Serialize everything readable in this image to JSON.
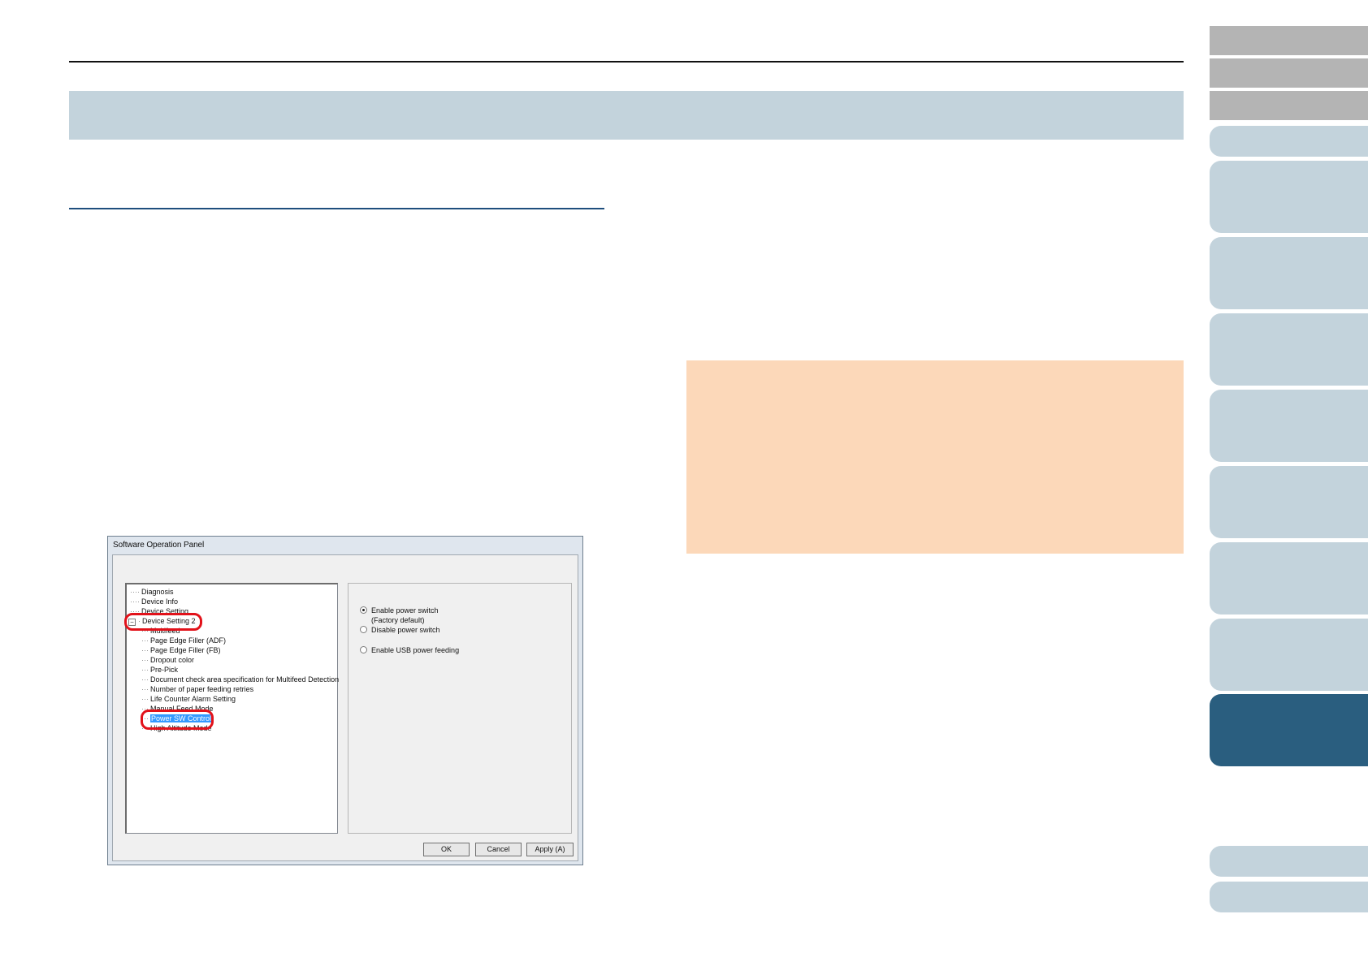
{
  "colors": {
    "title_band": "#c3d3dc",
    "section_rule": "#1f4e7d",
    "note_box": "#fcd8b9",
    "nav_gray": "#b4b4b4",
    "nav_light": "#c3d3dc",
    "nav_active": "#2a5e7f",
    "highlight_ring": "#e2121a",
    "selection": "#3399ff"
  },
  "nav_tabs": [
    {
      "style": "gray"
    },
    {
      "style": "gray"
    },
    {
      "style": "gray"
    },
    {
      "style": "light"
    },
    {
      "style": "light"
    },
    {
      "style": "light"
    },
    {
      "style": "light"
    },
    {
      "style": "light"
    },
    {
      "style": "light"
    },
    {
      "style": "light"
    },
    {
      "style": "light"
    },
    {
      "style": "active"
    },
    {
      "style": "light"
    },
    {
      "style": "light"
    }
  ],
  "dialog": {
    "title": "Software Operation Panel",
    "tree": [
      {
        "label": "Diagnosis",
        "level": 0
      },
      {
        "label": "Device Info",
        "level": 0
      },
      {
        "label": "Device Setting",
        "level": 0
      },
      {
        "label": "Device Setting 2",
        "level": 0,
        "expanded": true,
        "circled": true
      },
      {
        "label": "Multifeed",
        "level": 1
      },
      {
        "label": "Page Edge Filler (ADF)",
        "level": 1
      },
      {
        "label": "Page Edge Filler (FB)",
        "level": 1
      },
      {
        "label": "Dropout color",
        "level": 1
      },
      {
        "label": "Pre-Pick",
        "level": 1
      },
      {
        "label": "Document check area specification for Multifeed Detection",
        "level": 1
      },
      {
        "label": "Number of paper feeding retries",
        "level": 1
      },
      {
        "label": "Life Counter Alarm Setting",
        "level": 1
      },
      {
        "label": "Manual Feed Mode",
        "level": 1
      },
      {
        "label": "Power SW Control",
        "level": 1,
        "selected": true,
        "circled": true
      },
      {
        "label": "High Altitude Mode",
        "level": 1
      }
    ],
    "options": [
      {
        "label": "Enable power switch",
        "checked": true,
        "note": "(Factory default)"
      },
      {
        "label": "Disable power switch",
        "checked": false
      },
      {
        "label": "Enable USB power feeding",
        "checked": false
      }
    ],
    "buttons": {
      "ok": "OK",
      "cancel": "Cancel",
      "apply": "Apply (A)"
    }
  }
}
